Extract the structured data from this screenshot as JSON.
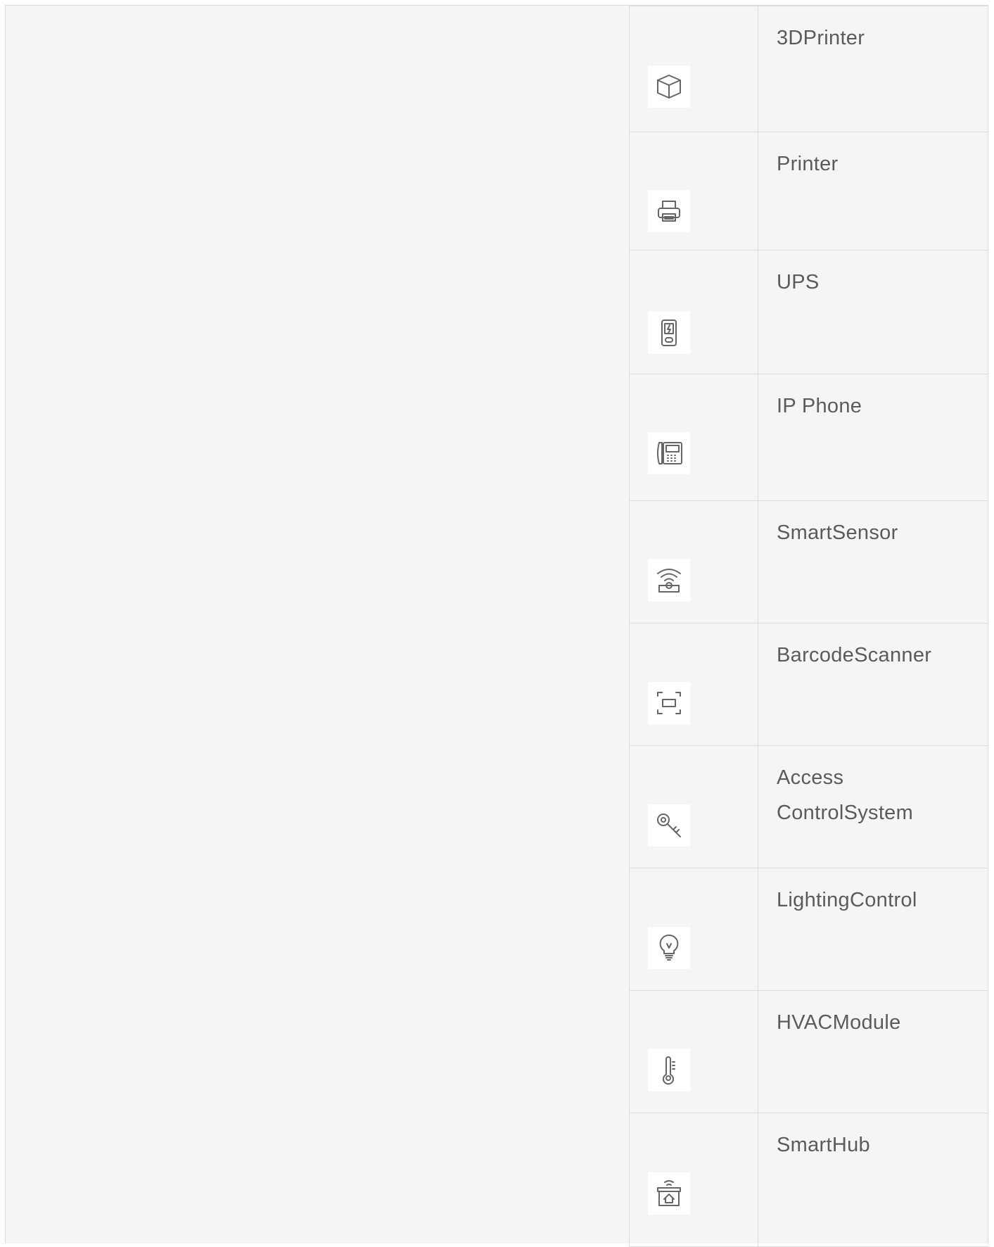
{
  "devices": [
    {
      "label": "3DPrinter",
      "icon": "cube-icon"
    },
    {
      "label": "Printer",
      "icon": "printer-icon"
    },
    {
      "label": "UPS",
      "icon": "ups-battery-icon"
    },
    {
      "label": "IP Phone",
      "icon": "desk-phone-icon"
    },
    {
      "label": "SmartSensor",
      "icon": "wireless-sensor-icon"
    },
    {
      "label": "BarcodeScanner",
      "icon": "scan-frame-icon"
    },
    {
      "label": "Access ControlSystem",
      "icon": "key-icon"
    },
    {
      "label": "LightingControl",
      "icon": "light-bulb-icon"
    },
    {
      "label": "HVACModule",
      "icon": "thermometer-icon"
    },
    {
      "label": "SmartHub",
      "icon": "smart-home-hub-icon"
    }
  ]
}
